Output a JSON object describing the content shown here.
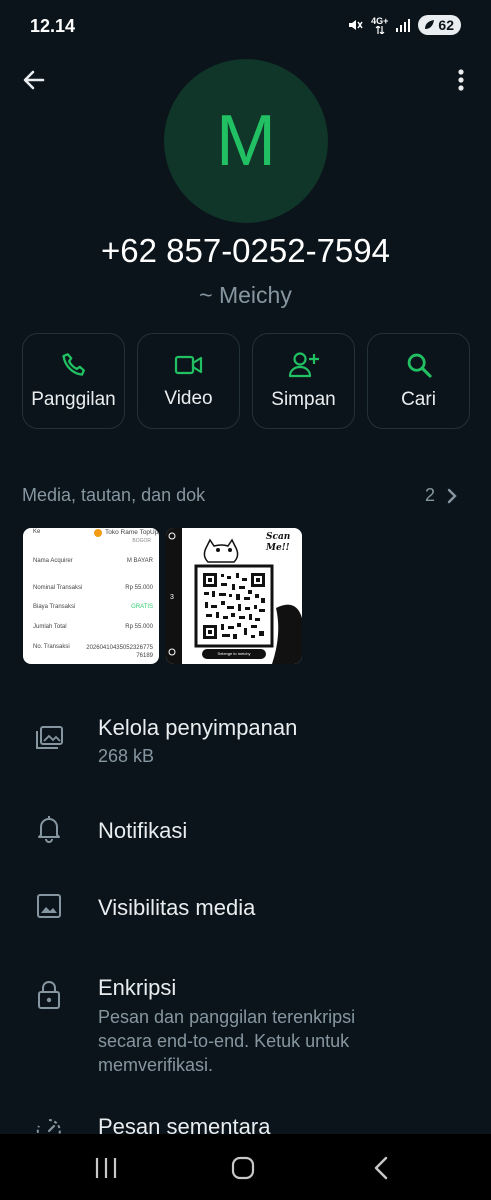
{
  "status_bar": {
    "time": "12.14",
    "network": "4G+",
    "battery": "62"
  },
  "header": {
    "back_icon": "arrow-left-icon",
    "menu_icon": "more-vertical-icon"
  },
  "contact": {
    "avatar_letter": "M",
    "phone": "+62 857-0252-7594",
    "name": "~ Meichy"
  },
  "actions": [
    {
      "label": "Panggilan",
      "icon": "phone-icon"
    },
    {
      "label": "Video",
      "icon": "video-icon"
    },
    {
      "label": "Simpan",
      "icon": "add-contact-icon"
    },
    {
      "label": "Cari",
      "icon": "search-icon"
    }
  ],
  "media": {
    "header": "Media, tautan, dan dok",
    "count": "2",
    "receipt": {
      "to_label": "Ke",
      "merchant": "Toko Rame TopUp",
      "city": "BOGOR",
      "rows": [
        {
          "label": "Nama Acquirer",
          "value": "M BAYAR"
        },
        {
          "label": "Nominal Transaksi",
          "value": "Rp 55.000"
        },
        {
          "label": "Biaya Transaksi",
          "value": "GRATIS"
        },
        {
          "label": "Jumlah Total",
          "value": "Rp 55.000"
        },
        {
          "label": "No. Transaksi",
          "value": "2026041043505232677576189"
        }
      ]
    },
    "qr": {
      "title": "Scan Me!!",
      "footer": "Selenge to meichy"
    }
  },
  "settings": [
    {
      "title": "Kelola penyimpanan",
      "subtitle": "268 kB",
      "icon": "storage-icon"
    },
    {
      "title": "Notifikasi",
      "icon": "bell-icon"
    },
    {
      "title": "Visibilitas media",
      "icon": "image-icon"
    },
    {
      "title": "Enkripsi",
      "subtitle": "Pesan dan panggilan terenkripsi secara end-to-end. Ketuk untuk memverifikasi.",
      "icon": "lock-icon"
    },
    {
      "title": "Pesan sementara",
      "icon": "timer-icon"
    }
  ],
  "colors": {
    "background": "#0b141a",
    "accent": "#21c063",
    "muted": "#8696a0",
    "avatar_bg": "#103529"
  }
}
